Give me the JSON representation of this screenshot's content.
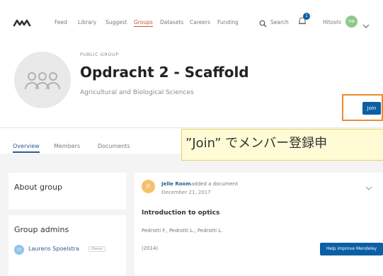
{
  "nav": {
    "items": [
      "Feed",
      "Library",
      "Suggest",
      "Groups",
      "Datasets",
      "Careers",
      "Funding"
    ],
    "search_label": "Search",
    "notification_count": "1",
    "user_name": "Hitoshi",
    "user_initials": "HA"
  },
  "group": {
    "eyebrow": "PUBLIC GROUP",
    "title": "Opdracht 2 - Scaffold",
    "subtitle": "Agricultural and Biological Sciences",
    "join_label": "Join"
  },
  "tabs": [
    "Overview",
    "Members",
    "Documents"
  ],
  "callout": "”Join” でメンバー登録申",
  "sidebar": {
    "about_title": "About group",
    "admins_title": "Group admins",
    "admin": {
      "initials": "LS",
      "name": "Laurens Spoelstra",
      "role": "Owner"
    }
  },
  "post": {
    "avatar_initials": "JR",
    "author": "Jelle Room",
    "action": "added a document",
    "date": "December 21, 2017",
    "doc_title": "Introduction to optics",
    "authors": "Pedrotti F., Pedrotti L., Pedrotti L.",
    "year": "(2014)",
    "help_label": "Help improve Mendeley"
  }
}
